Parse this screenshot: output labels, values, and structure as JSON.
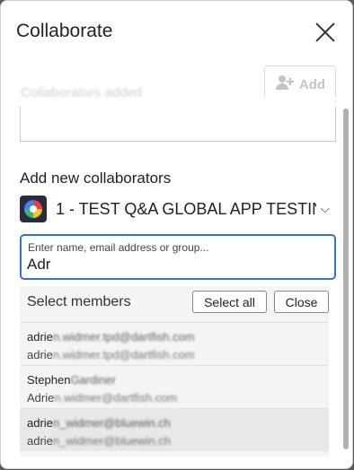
{
  "dialog": {
    "title": "Collaborate"
  },
  "collaborators": {
    "label": "Collaborators added",
    "add_label": "Add"
  },
  "new": {
    "section_label": "Add new collaborators",
    "group_name": "1 - TEST Q&A GLOBAL APP TESTIN...",
    "input_placeholder": "Enter name, email address or group...",
    "input_value": "Adr"
  },
  "members": {
    "title": "Select members",
    "select_all_label": "Select all",
    "close_label": "Close",
    "items": [
      {
        "name_visible": "adrie",
        "name_hidden": "n.widmer.tpd@dartfish.com",
        "email_visible": "adrie",
        "email_hidden": "n.widmer.tpd@dartfish.com"
      },
      {
        "name_visible": "Stephen",
        "name_hidden": "Gardiner",
        "email_visible": "Adrie",
        "email_hidden": "n.widmer@dartfish.com"
      },
      {
        "name_visible": "adrie",
        "name_hidden": "n_widmer@bluewin.ch",
        "email_visible": "adrie",
        "email_hidden": "n_widmer@bluewin.ch"
      }
    ]
  }
}
